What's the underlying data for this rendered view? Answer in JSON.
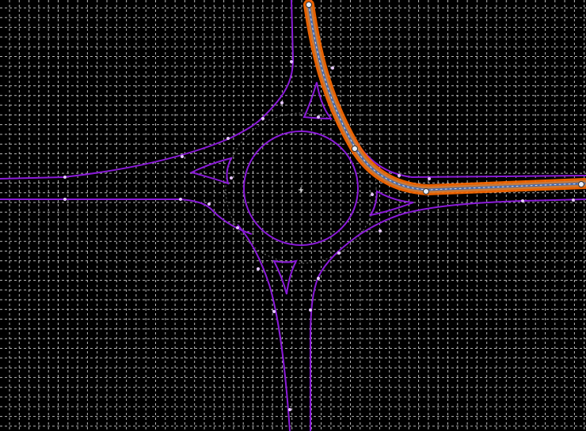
{
  "colors": {
    "background": "#000000",
    "grid": "#d8d8d8",
    "road": "#8a1ad8",
    "node": "#e6c8ff",
    "path_outer": "#ff6a00",
    "path_mid": "#c87a3a",
    "path_inner": "#4a6aa8",
    "path_node": "#e8f0ff",
    "guide": "#6a6a6a"
  },
  "icons": {
    "center_marker": "crosshair-icon"
  },
  "selection": {
    "state": "selected",
    "label": ""
  }
}
